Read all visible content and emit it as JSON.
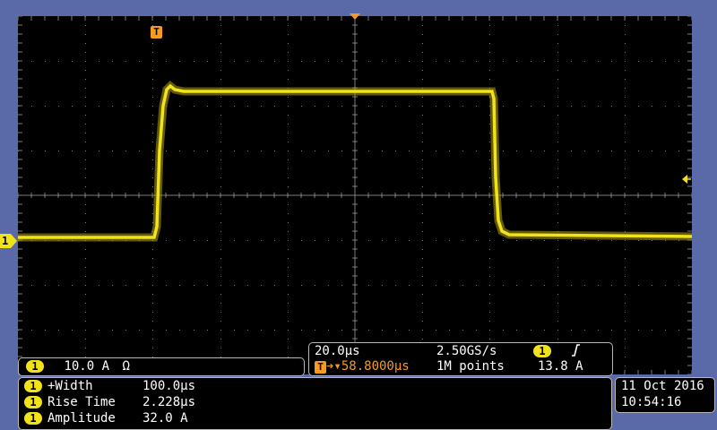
{
  "channel_scale": {
    "channel": "1",
    "value": "10.0 A",
    "unit_symbol": "Ω"
  },
  "horizontal": {
    "time_div": "20.0µs",
    "sample_rate": "2.50GS/s",
    "trigger_channel": "1",
    "trigger_slope_icon": "rising-edge-icon",
    "trigger_position": "58.8000µs",
    "record_length": "1M points",
    "trigger_level": "13.8 A"
  },
  "measurements": [
    {
      "channel": "1",
      "name": "+Width",
      "value": "100.0µs"
    },
    {
      "channel": "1",
      "name": "Rise Time",
      "value": "2.228µs"
    },
    {
      "channel": "1",
      "name": "Amplitude",
      "value": "32.0 A"
    }
  ],
  "datetime": {
    "date": "11 Oct  2016",
    "time": "10:54:16"
  },
  "markers": {
    "channel_ref": "1",
    "trigger_marker": "T"
  },
  "colors": {
    "channel1": "#f2e21a",
    "trigger": "#f79a1e",
    "grid": "#7a7a7a",
    "frame": "#5a6aa8"
  }
}
